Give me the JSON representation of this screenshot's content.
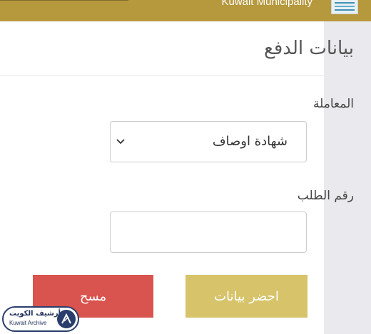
{
  "header": {
    "title": "Kuwait Municipality",
    "logo_icon": "kuwait-municipality-logo-icon",
    "bar_color": "#b6983d"
  },
  "form": {
    "title": "بيانات الدفع",
    "transaction": {
      "label": "المعاملة",
      "selected": "شهادة اوصاف",
      "icon": "chevron-down-icon"
    },
    "request_number": {
      "label": "رقم الطلب",
      "value": "",
      "placeholder": ""
    }
  },
  "buttons": {
    "fetch_label": "احضر بيانات",
    "fetch_color": "#d7c36a",
    "clear_label": "مسح",
    "clear_color": "#d9534f"
  },
  "watermark": {
    "text_ar": "أرشيف الكويت",
    "text_en": "Kuwait Archive",
    "icon": "kuwait-archive-logo-icon"
  }
}
